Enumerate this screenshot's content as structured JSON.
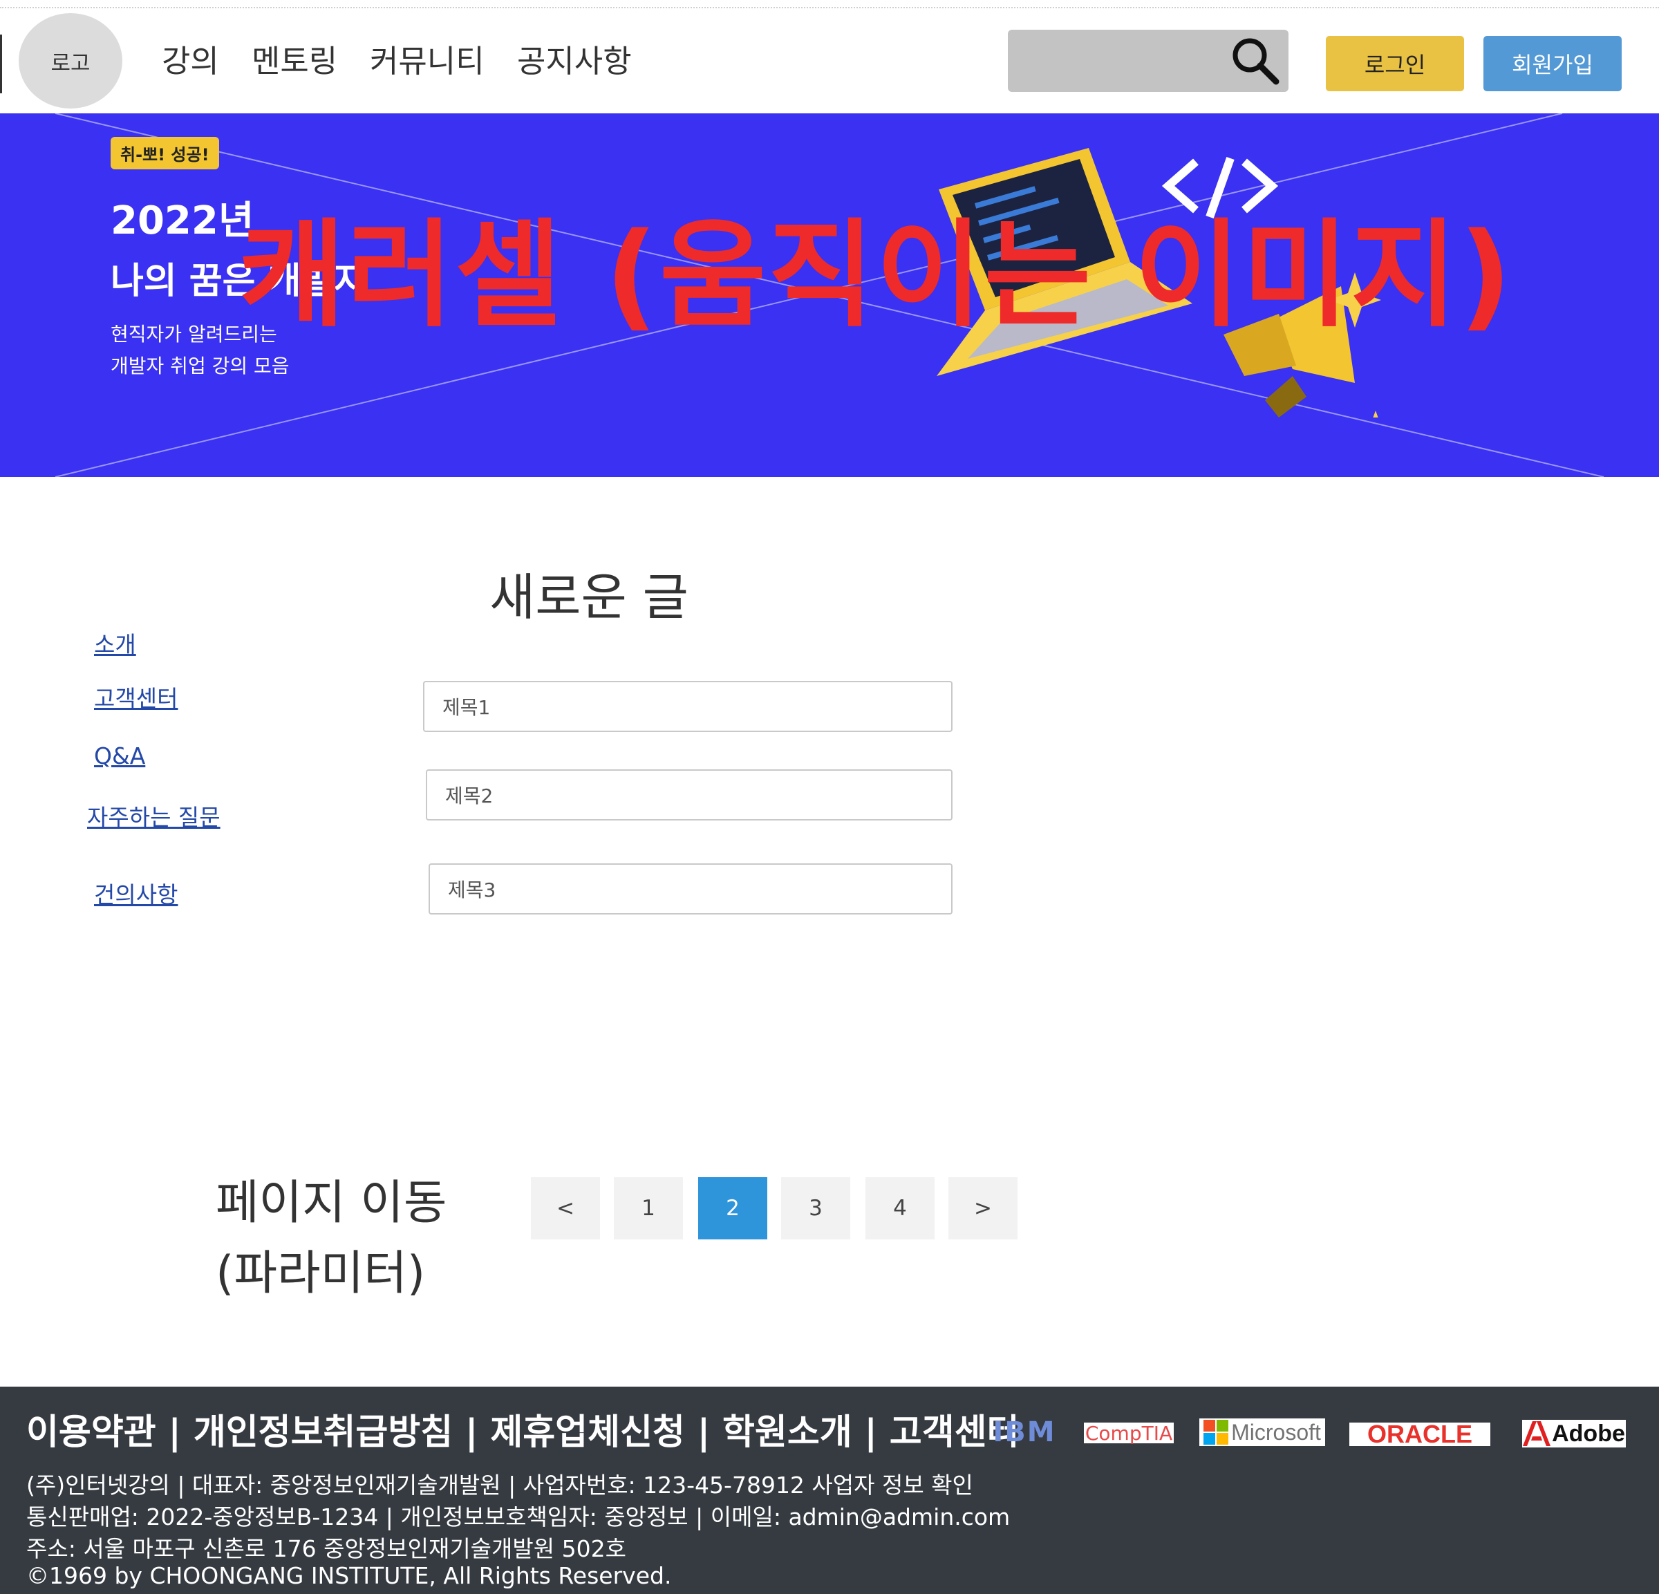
{
  "header": {
    "logo": "로고",
    "nav": [
      "강의",
      "멘토링",
      "커뮤니티",
      "공지사항"
    ],
    "search_placeholder": "",
    "login_label": "로그인",
    "join_label": "회원가입"
  },
  "banner": {
    "badge": "취-뽀! 성공!",
    "year": "2022년",
    "headline": "나의 꿈은 개발자",
    "sub1": "현직자가 알려드리는",
    "sub2": "개발자 취업 강의 모음",
    "code_symbol": "</>",
    "overlay": "캐러셀 (움직이는 이미지)"
  },
  "section": {
    "title": "새로운 글",
    "side_links": [
      "소개",
      "고객센터",
      "Q&A",
      "자주하는 질문",
      "건의사항"
    ],
    "posts": [
      "제목1",
      "제목2",
      "제목3"
    ]
  },
  "pagination": {
    "label_line1": "페이지 이동",
    "label_line2": "(파라미터)",
    "prev": "<",
    "pages": [
      "1",
      "2",
      "3",
      "4"
    ],
    "next": ">",
    "current": "2"
  },
  "footer": {
    "links": "이용약관 | 개인정보취급방침 | 제휴업체신청 | 학원소개 | 고객센터",
    "line1": "(주)인터넷강의 | 대표자: 중앙정보인재기술개발원 | 사업자번호: 123-45-78912 사업자 정보 확인",
    "line2": "통신판매업: 2022-중앙정보B-1234 | 개인정보보호책임자: 중앙정보 | 이메일: admin@admin.com",
    "line3": "주소: 서울 마포구 신촌로 176 중앙정보인재기술개발원 502호",
    "line4": "©1969 by CHOONGANG INSTITUTE, All Rights Reserved.",
    "brands": [
      "IBM",
      "CompTIA",
      "Microsoft",
      "ORACLE",
      "Adobe"
    ]
  },
  "colors": {
    "banner_bg": "#3a31f2",
    "login_btn": "#e9c143",
    "join_btn": "#5399d6",
    "active_page": "#2f95db",
    "footer_bg": "#363b42",
    "overlay_text": "#ee2a2a"
  }
}
